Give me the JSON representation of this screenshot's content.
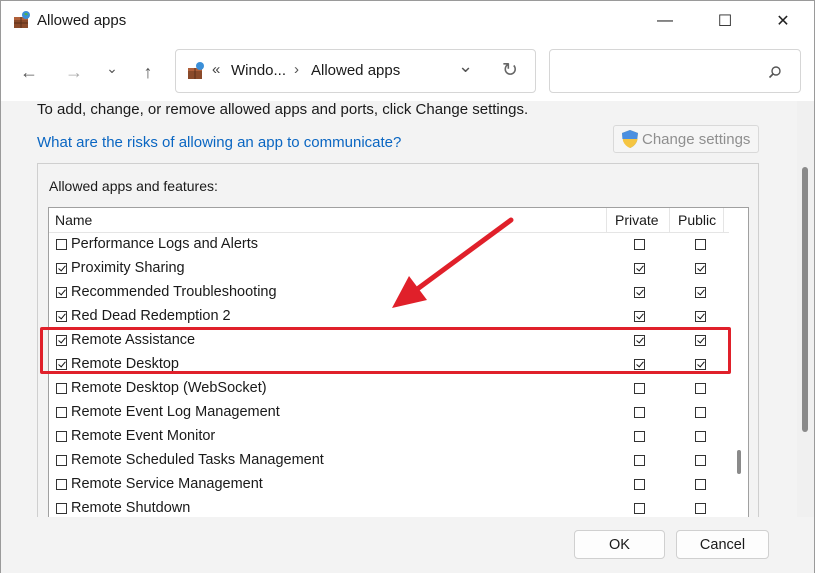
{
  "window": {
    "title": "Allowed apps",
    "minimize_glyph": "—",
    "maximize_glyph": "☐",
    "close_glyph": "✕"
  },
  "address": {
    "overflow_glyph": "«",
    "crumb_1": "Windo...",
    "separator": "›",
    "crumb_2": "Allowed apps",
    "dropdown_glyph": "⌄",
    "refresh_glyph": "↻",
    "search_placeholder": "",
    "search_glyph": "⚲"
  },
  "nav": {
    "back_glyph": "←",
    "forward_glyph": "→",
    "recent_glyph": "⌄",
    "up_glyph": "↑"
  },
  "content": {
    "instructions": "To add, change, or remove allowed apps and ports, click Change settings.",
    "risk_link": "What are the risks of allowing an app to communicate?",
    "change_settings_label": "Change settings",
    "group_label": "Allowed apps and features:"
  },
  "list": {
    "headers": {
      "name": "Name",
      "private": "Private",
      "public": "Public"
    },
    "rows": [
      {
        "label": "Performance Logs and Alerts",
        "enabled": false,
        "private": false,
        "public": false
      },
      {
        "label": "Proximity Sharing",
        "enabled": true,
        "private": true,
        "public": true
      },
      {
        "label": "Recommended Troubleshooting",
        "enabled": true,
        "private": true,
        "public": true
      },
      {
        "label": "Red Dead Redemption 2",
        "enabled": true,
        "private": true,
        "public": true
      },
      {
        "label": "Remote Assistance",
        "enabled": true,
        "private": true,
        "public": true
      },
      {
        "label": "Remote Desktop",
        "enabled": true,
        "private": true,
        "public": true
      },
      {
        "label": "Remote Desktop (WebSocket)",
        "enabled": false,
        "private": false,
        "public": false
      },
      {
        "label": "Remote Event Log Management",
        "enabled": false,
        "private": false,
        "public": false
      },
      {
        "label": "Remote Event Monitor",
        "enabled": false,
        "private": false,
        "public": false
      },
      {
        "label": "Remote Scheduled Tasks Management",
        "enabled": false,
        "private": false,
        "public": false
      },
      {
        "label": "Remote Service Management",
        "enabled": false,
        "private": false,
        "public": false
      },
      {
        "label": "Remote Shutdown",
        "enabled": false,
        "private": false,
        "public": false
      }
    ]
  },
  "footer": {
    "ok_label": "OK",
    "cancel_label": "Cancel"
  },
  "colors": {
    "link": "#0a66c2",
    "annotation": "#e0202a"
  }
}
